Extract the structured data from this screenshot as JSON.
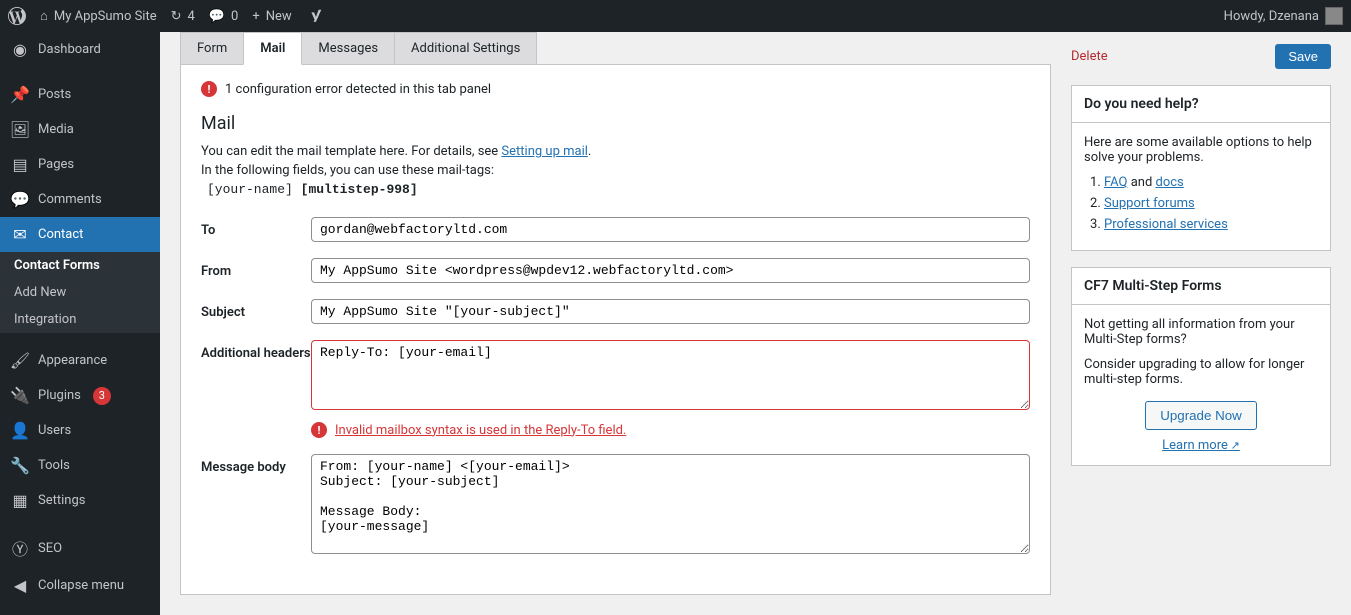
{
  "adminbar": {
    "site_name": "My AppSumo Site",
    "updates": "4",
    "comments": "0",
    "new": "New",
    "howdy": "Howdy, Dzenana"
  },
  "sidebar": {
    "items": [
      {
        "label": "Dashboard"
      },
      {
        "label": "Posts"
      },
      {
        "label": "Media"
      },
      {
        "label": "Pages"
      },
      {
        "label": "Comments"
      },
      {
        "label": "Contact"
      },
      {
        "label": "Appearance"
      },
      {
        "label": "Plugins",
        "badge": "3"
      },
      {
        "label": "Users"
      },
      {
        "label": "Tools"
      },
      {
        "label": "Settings"
      },
      {
        "label": "SEO"
      },
      {
        "label": "Collapse menu"
      }
    ],
    "submenu": [
      {
        "label": "Contact Forms"
      },
      {
        "label": "Add New"
      },
      {
        "label": "Integration"
      }
    ]
  },
  "tabs": [
    "Form",
    "Mail",
    "Messages",
    "Additional Settings"
  ],
  "panel": {
    "error_msg": "1 configuration error detected in this tab panel",
    "title": "Mail",
    "desc1_pre": "You can edit the mail template here. For details, see ",
    "desc1_link": "Setting up mail",
    "desc1_post": ".",
    "desc2": "In the following fields, you can use these mail-tags:",
    "mailtag1": "[your-name]",
    "mailtag2": "[multistep-998]"
  },
  "fields": {
    "to": {
      "label": "To",
      "value": "gordan@webfactoryltd.com"
    },
    "from": {
      "label": "From",
      "value": "My AppSumo Site <wordpress@wpdev12.webfactoryltd.com>"
    },
    "subject": {
      "label": "Subject",
      "value": "My AppSumo Site \"[your-subject]\""
    },
    "headers": {
      "label": "Additional headers",
      "value": "Reply-To: [your-email]",
      "error": "Invalid mailbox syntax is used in the Reply-To field."
    },
    "body": {
      "label": "Message body",
      "value": "From: [your-name] <[your-email]>\nSubject: [your-subject]\n\nMessage Body:\n[your-message]"
    }
  },
  "sidecol": {
    "delete": "Delete",
    "save": "Save",
    "help": {
      "title": "Do you need help?",
      "intro": "Here are some available options to help solve your problems.",
      "faq": "FAQ",
      "and": " and ",
      "docs": "docs",
      "forums": "Support forums",
      "pro": "Professional services"
    },
    "multi": {
      "title": "CF7 Multi-Step Forms",
      "p1": "Not getting all information from your Multi-Step forms?",
      "p2": "Consider upgrading to allow for longer multi-step forms.",
      "upgrade": "Upgrade Now",
      "learn": "Learn more"
    }
  }
}
